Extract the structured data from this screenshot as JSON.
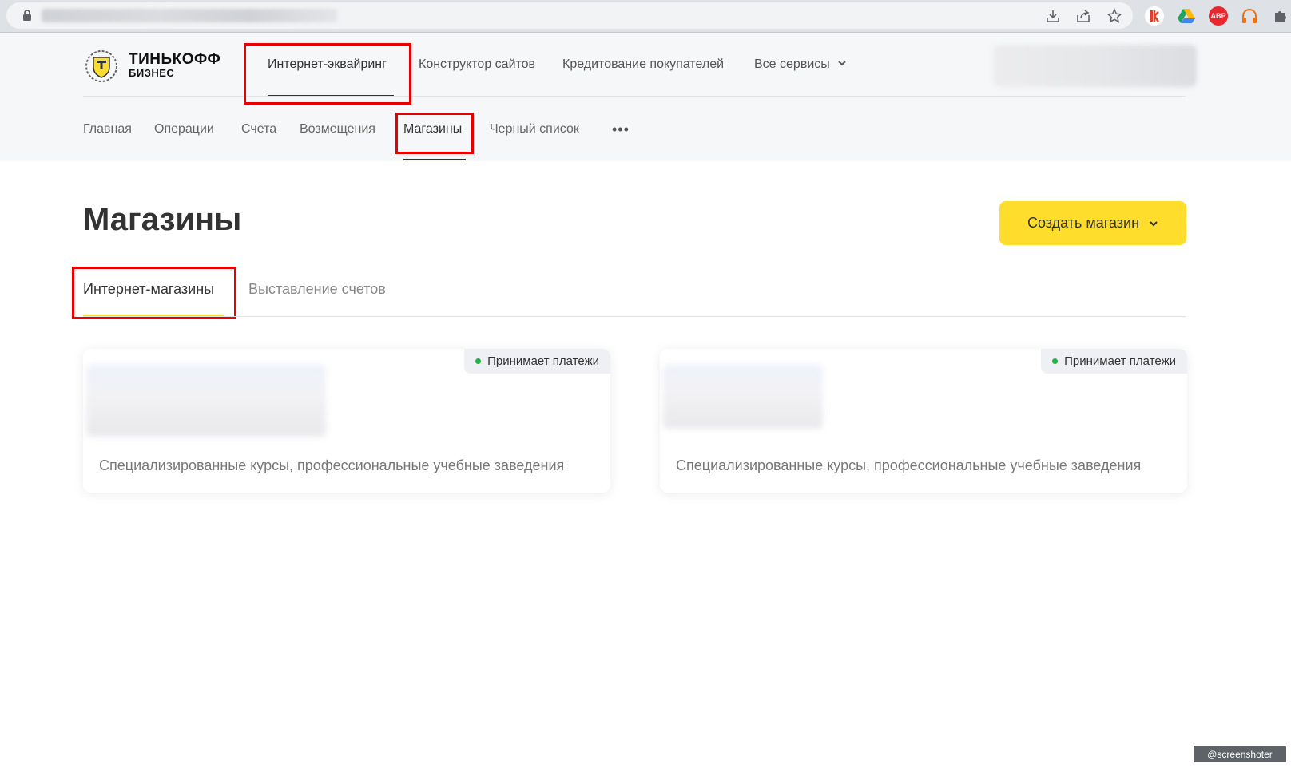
{
  "browser": {
    "icons": [
      "lock-icon",
      "download-icon",
      "share-icon",
      "star-icon",
      "extension-k-icon",
      "drive-icon",
      "adblock-icon",
      "headphones-icon",
      "puzzle-icon"
    ],
    "adblock_label": "ABP"
  },
  "logo": {
    "line1": "ТИНЬКОФФ",
    "line2": "БИЗНЕС"
  },
  "top_nav": {
    "items": [
      "Интернет-эквайринг",
      "Конструктор сайтов",
      "Кредитование покупателей",
      "Все сервисы"
    ],
    "active": "Интернет-эквайринг"
  },
  "sub_nav": {
    "items": [
      "Главная",
      "Операции",
      "Счета",
      "Возмещения",
      "Магазины",
      "Черный список"
    ],
    "more": "•••",
    "active": "Магазины"
  },
  "page": {
    "title": "Магазины",
    "create_button": "Создать магазин",
    "tabs": [
      "Интернет-магазины",
      "Выставление счетов"
    ],
    "active_tab": "Интернет-магазины"
  },
  "shops": [
    {
      "status": "Принимает платежи",
      "category": "Специализированные курсы, профессиональные учебные заведения"
    },
    {
      "status": "Принимает платежи",
      "category": "Специализированные курсы, профессиональные учебные заведения"
    }
  ],
  "watermark": "@screenshoter",
  "colors": {
    "accent": "#ffdd2d",
    "status_green": "#1fb34a",
    "annotation_red": "#e60000"
  }
}
